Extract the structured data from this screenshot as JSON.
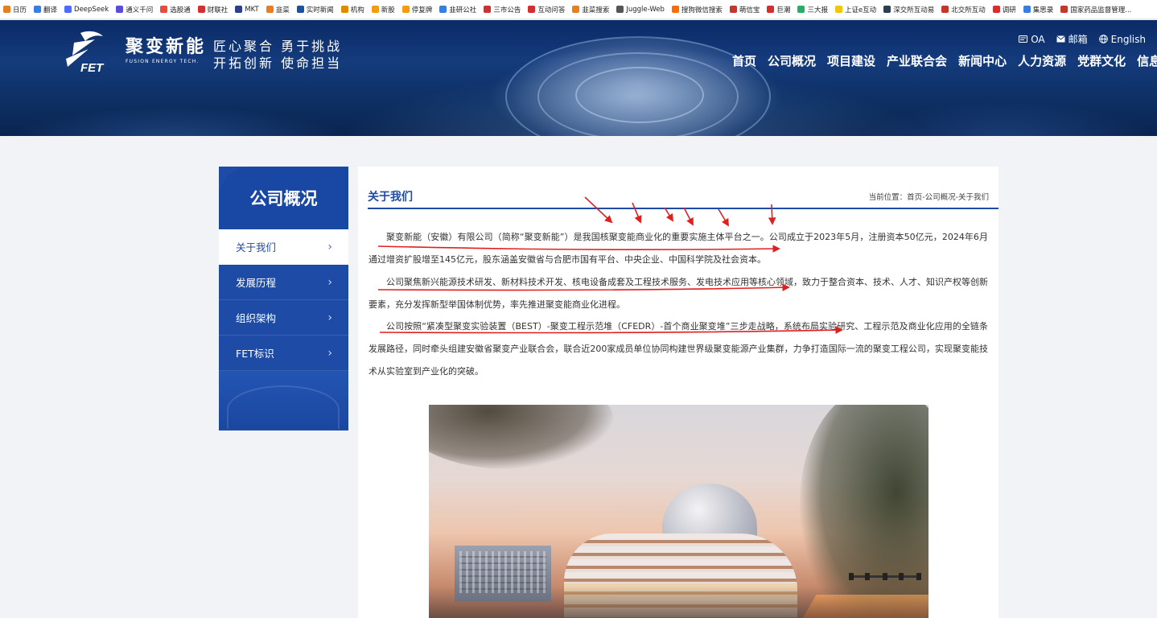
{
  "bookmarks": [
    {
      "label": "日历",
      "icon": "calendar-icon",
      "color": "#e67e22"
    },
    {
      "label": "翻译",
      "icon": "translate-icon",
      "color": "#3b7ddd"
    },
    {
      "label": "DeepSeek",
      "icon": "deepseek-icon",
      "color": "#4d6bfe"
    },
    {
      "label": "通义千问",
      "icon": "tongyi-icon",
      "color": "#5a4cdb"
    },
    {
      "label": "选股通",
      "icon": "xuangutong-icon",
      "color": "#e74c3c"
    },
    {
      "label": "财联社",
      "icon": "cailianshe-icon",
      "color": "#d32f2f"
    },
    {
      "label": "MKT",
      "icon": "mkt-icon",
      "color": "#2c3e8f"
    },
    {
      "label": "韭菜",
      "icon": "jiucai-icon",
      "color": "#e67e22"
    },
    {
      "label": "实时新闻",
      "icon": "news-icon",
      "color": "#1e50a2"
    },
    {
      "label": "机构",
      "icon": "institution-icon",
      "color": "#e08a00"
    },
    {
      "label": "新股",
      "icon": "newstock-icon",
      "color": "#f39c12"
    },
    {
      "label": "停复牌",
      "icon": "suspension-icon",
      "color": "#f39c12"
    },
    {
      "label": "韭研公社",
      "icon": "jiuyan-icon",
      "color": "#3b7ddd"
    },
    {
      "label": "三市公告",
      "icon": "announcement-icon",
      "color": "#d32f2f"
    },
    {
      "label": "互动问答",
      "icon": "qa-icon",
      "color": "#d32f2f"
    },
    {
      "label": "韭菜搜索",
      "icon": "search-icon",
      "color": "#e67e22"
    },
    {
      "label": "Juggle-Web",
      "icon": "globe-icon",
      "color": "#555555"
    },
    {
      "label": "搜狗微信搜索",
      "icon": "sogou-icon",
      "color": "#ff6a00"
    },
    {
      "label": "萌信宝",
      "icon": "mengxinbao-icon",
      "color": "#c0392b"
    },
    {
      "label": "巨潮",
      "icon": "juchao-icon",
      "color": "#d32f2f"
    },
    {
      "label": "三大报",
      "icon": "newspaper-icon",
      "color": "#27ae60"
    },
    {
      "label": "上证e互动",
      "icon": "sse-icon",
      "color": "#f1c40f"
    },
    {
      "label": "深交所互动易",
      "icon": "szse-icon",
      "color": "#2c3e50"
    },
    {
      "label": "北交所互动",
      "icon": "bse-icon",
      "color": "#c0392b"
    },
    {
      "label": "调研",
      "icon": "research-icon",
      "color": "#d32f2f"
    },
    {
      "label": "集思录",
      "icon": "jisilu-icon",
      "color": "#3b7ddd"
    },
    {
      "label": "国家药品监督管理...",
      "icon": "nmpa-icon",
      "color": "#c0392b"
    }
  ],
  "header": {
    "brand_cn": "聚变新能",
    "brand_en": "FUSION ENERGY TECH.",
    "logo_letters": "FET",
    "slogan_line1": "匠心聚合 勇于挑战",
    "slogan_line2": "开拓创新 使命担当",
    "top_links": [
      {
        "label": "OA",
        "icon": "oa-icon"
      },
      {
        "label": "邮箱",
        "icon": "mail-icon"
      },
      {
        "label": "English",
        "icon": "globe-icon"
      }
    ],
    "nav": [
      "首页",
      "公司概况",
      "项目建设",
      "产业联合会",
      "新闻中心",
      "人力资源",
      "党群文化",
      "信息公"
    ]
  },
  "sidebar": {
    "title": "公司概况",
    "items": [
      {
        "label": "关于我们",
        "active": true
      },
      {
        "label": "发展历程",
        "active": false
      },
      {
        "label": "组织架构",
        "active": false
      },
      {
        "label": "FET标识",
        "active": false
      }
    ],
    "chevron": "›"
  },
  "main": {
    "title": "关于我们",
    "breadcrumb": "当前位置：首页-公司概况-关于我们",
    "paragraphs": [
      "聚变新能（安徽）有限公司（简称“聚变新能”）是我国核聚变能商业化的重要实施主体平台之一。公司成立于2023年5月，注册资本50亿元，2024年6月通过增资扩股增至145亿元，股东涵盖安徽省与合肥市国有平台、中央企业、中国科学院及社会资本。",
      "公司聚焦新兴能源技术研发、新材料技术开发、核电设备成套及工程技术服务、发电技术应用等核心领域，致力于整合资本、技术、人才、知识产权等创新要素，充分发挥新型举国体制优势，率先推进聚变能商业化进程。",
      "公司按照“紧凑型聚变实验装置（BEST）-聚变工程示范堆（CFEDR）-首个商业聚变堆”三步走战略，系统布局实验研究、工程示范及商业化应用的全链条发展路径，同时牵头组建安徽省聚变产业联合会，联合近200家成员单位协同构建世界级聚变能源产业集群，力争打造国际一流的聚变工程公司，实现聚变能技术从实验室到产业化的突破。"
    ]
  },
  "colors": {
    "brand_blue": "#1d4ba6",
    "annotation_red": "#e02020"
  }
}
